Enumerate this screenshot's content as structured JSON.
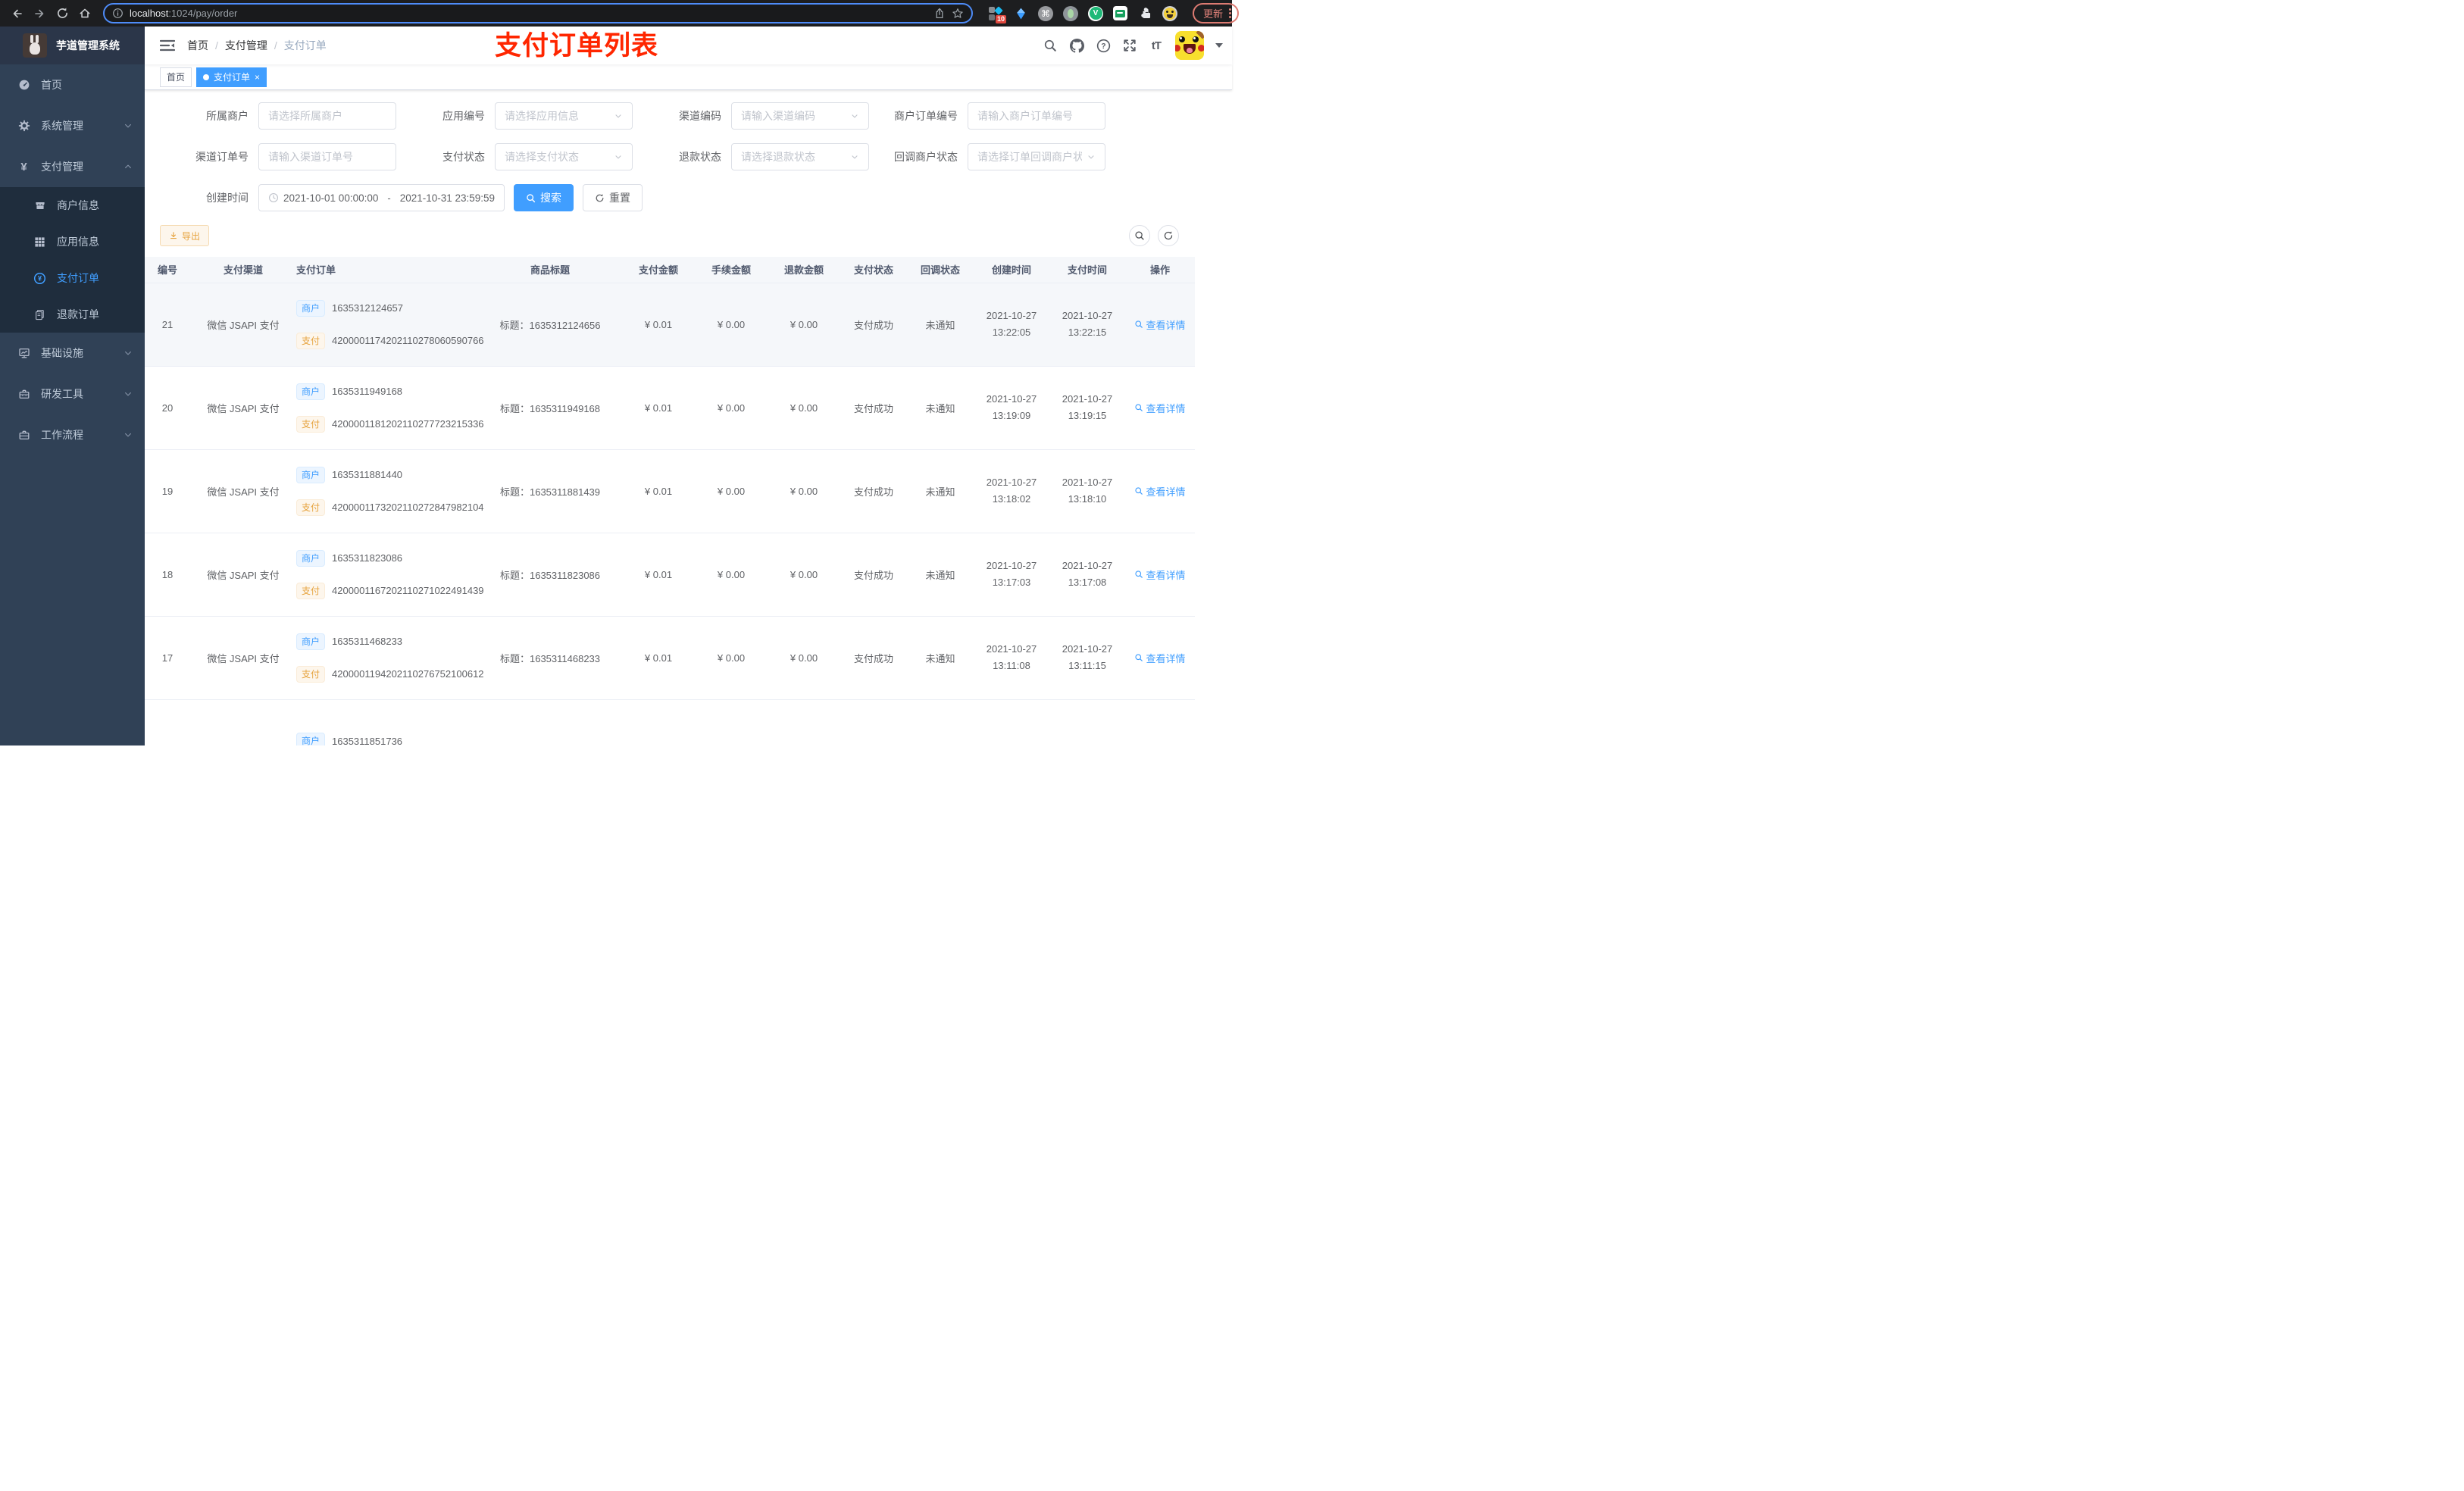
{
  "browser": {
    "url_host": "localhost",
    "url_rest": ":1024/pay/order",
    "ext_badge": "10",
    "vue_letter": "V",
    "cmd_glyph": "⌘",
    "update_label": "更新"
  },
  "sidebar": {
    "title": "芋道管理系统",
    "items": {
      "home": "首页",
      "system": "系统管理",
      "pay": "支付管理",
      "merchant": "商户信息",
      "application": "应用信息",
      "pay_order": "支付订单",
      "refund_order": "退款订单",
      "infra": "基础设施",
      "devtools": "研发工具",
      "workflow": "工作流程"
    }
  },
  "header": {
    "breadcrumb": [
      "首页",
      "支付管理",
      "支付订单"
    ],
    "annotation": "支付订单列表",
    "font_size_icon": "tT"
  },
  "tags": {
    "home": "首页",
    "current": "支付订单",
    "close": "×"
  },
  "filters": {
    "row1": [
      {
        "label": "所属商户",
        "placeholder": "请选择所属商户"
      },
      {
        "label": "应用编号",
        "placeholder": "请选择应用信息"
      },
      {
        "label": "渠道编码",
        "placeholder": "请输入渠道编码"
      },
      {
        "label": "商户订单编号",
        "placeholder": "请输入商户订单编号"
      }
    ],
    "row2": [
      {
        "label": "渠道订单号",
        "placeholder": "请输入渠道订单号"
      },
      {
        "label": "支付状态",
        "placeholder": "请选择支付状态"
      },
      {
        "label": "退款状态",
        "placeholder": "请选择退款状态"
      },
      {
        "label": "回调商户状态",
        "placeholder": "请选择订单回调商户状态"
      }
    ],
    "date": {
      "label": "创建时间",
      "start": "2021-10-01 00:00:00",
      "separator": "-",
      "end": "2021-10-31 23:59:59"
    },
    "search_label": "搜索",
    "reset_label": "重置"
  },
  "toolbar": {
    "export_label": "导出"
  },
  "table": {
    "columns": [
      "编号",
      "支付渠道",
      "支付订单",
      "商品标题",
      "支付金额",
      "手续金额",
      "退款金额",
      "支付状态",
      "回调状态",
      "创建时间",
      "支付时间",
      "操作"
    ],
    "merchant_tag": "商户",
    "pay_tag": "支付",
    "action_label": "查看详情",
    "rows": [
      {
        "id": "21",
        "channel": "微信 JSAPI 支付",
        "merchant_no": "1635312124657",
        "pay_no": "4200001174202110278060590766",
        "title": "标题：1635312124656",
        "amount": "¥ 0.01",
        "fee": "¥ 0.00",
        "refund": "¥ 0.00",
        "status": "支付成功",
        "notify": "未通知",
        "create_date": "2021-10-27",
        "create_time": "13:22:05",
        "pay_date": "2021-10-27",
        "pay_time": "13:22:15"
      },
      {
        "id": "20",
        "channel": "微信 JSAPI 支付",
        "merchant_no": "1635311949168",
        "pay_no": "4200001181202110277723215336",
        "title": "标题：1635311949168",
        "amount": "¥ 0.01",
        "fee": "¥ 0.00",
        "refund": "¥ 0.00",
        "status": "支付成功",
        "notify": "未通知",
        "create_date": "2021-10-27",
        "create_time": "13:19:09",
        "pay_date": "2021-10-27",
        "pay_time": "13:19:15"
      },
      {
        "id": "19",
        "channel": "微信 JSAPI 支付",
        "merchant_no": "1635311881440",
        "pay_no": "4200001173202110272847982104",
        "title": "标题：1635311881439",
        "amount": "¥ 0.01",
        "fee": "¥ 0.00",
        "refund": "¥ 0.00",
        "status": "支付成功",
        "notify": "未通知",
        "create_date": "2021-10-27",
        "create_time": "13:18:02",
        "pay_date": "2021-10-27",
        "pay_time": "13:18:10"
      },
      {
        "id": "18",
        "channel": "微信 JSAPI 支付",
        "merchant_no": "1635311823086",
        "pay_no": "4200001167202110271022491439",
        "title": "标题：1635311823086",
        "amount": "¥ 0.01",
        "fee": "¥ 0.00",
        "refund": "¥ 0.00",
        "status": "支付成功",
        "notify": "未通知",
        "create_date": "2021-10-27",
        "create_time": "13:17:03",
        "pay_date": "2021-10-27",
        "pay_time": "13:17:08"
      },
      {
        "id": "17",
        "channel": "微信 JSAPI 支付",
        "merchant_no": "1635311468233",
        "pay_no": "4200001194202110276752100612",
        "title": "标题：1635311468233",
        "amount": "¥ 0.01",
        "fee": "¥ 0.00",
        "refund": "¥ 0.00",
        "status": "支付成功",
        "notify": "未通知",
        "create_date": "2021-10-27",
        "create_time": "13:11:08",
        "pay_date": "2021-10-27",
        "pay_time": "13:11:15"
      }
    ],
    "partial_row": {
      "merchant_no": "1635311851736"
    }
  },
  "colors": {
    "accent": "#409eff",
    "warning": "#e6a23c",
    "annotation_red": "#ff2600",
    "sidebar_bg": "#304156",
    "submenu_bg": "#1f2d3d"
  }
}
